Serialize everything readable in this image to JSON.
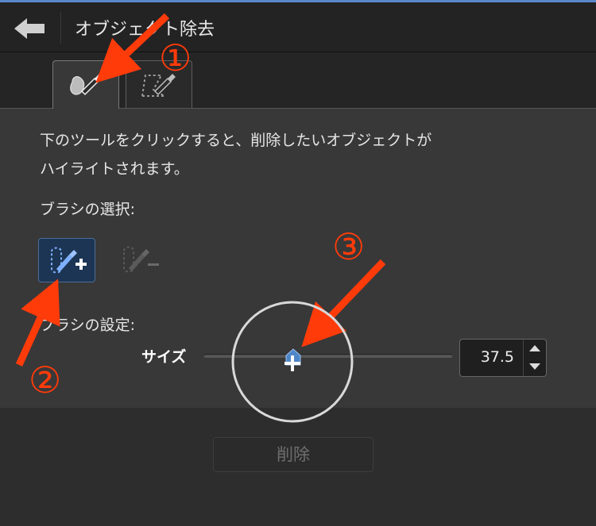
{
  "header": {
    "title": "オブジェクト除去",
    "back_icon": "back-arrow-icon"
  },
  "tabs": [
    {
      "icon": "brush-object-icon",
      "active": true
    },
    {
      "icon": "lasso-brush-icon",
      "active": false
    }
  ],
  "instructions": {
    "line1": "下のツールをクリックすると、削除したいオブジェクトが",
    "line2": "ハイライトされます。"
  },
  "brush_select": {
    "label": "ブラシの選択:",
    "buttons": [
      {
        "icon": "add-brush-icon",
        "selected": true
      },
      {
        "icon": "remove-brush-icon",
        "selected": false
      }
    ]
  },
  "brush_settings": {
    "label": "ブラシの設定:",
    "size_label": "サイズ",
    "size_value": "37.5",
    "slider_fraction": 0.36
  },
  "actions": {
    "delete_label": "削除"
  },
  "annotations": {
    "n1": "①",
    "n2": "②",
    "n3": "③",
    "color": "#ff3b0a"
  },
  "colors": {
    "accent": "#5a87c9",
    "selected_button": "#1d3554",
    "annotation": "#ff3b0a"
  }
}
